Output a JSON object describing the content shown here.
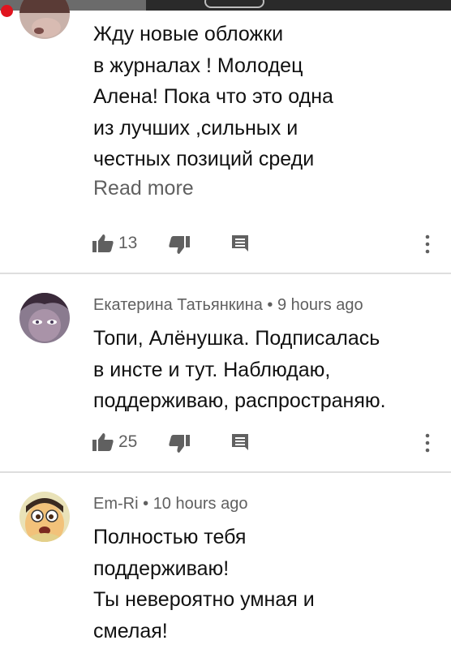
{
  "comments": [
    {
      "author": "",
      "time": "",
      "lines": [
        "Жду новые обложки",
        "в журналах ! Молодец",
        "Алена! Пока что это одна",
        "из лучших ,сильных и",
        "честных позиций среди"
      ],
      "read_more": "Read more",
      "likes": "13"
    },
    {
      "author": "Екатерина Татьянкина",
      "separator": "•",
      "time": "9 hours ago",
      "lines": [
        "Топи, Алёнушка. Подписалась",
        "в инсте и тут. Наблюдаю,",
        "поддерживаю, распространяю."
      ],
      "likes": "25"
    },
    {
      "author": "Em-Ri",
      "separator": "•",
      "time": "10 hours ago",
      "lines": [
        "Полностью тебя",
        "поддерживаю!",
        "Ты невероятно умная и",
        "смелая!"
      ]
    }
  ],
  "icons": {
    "like": "thumb-up-icon",
    "dislike": "thumb-down-icon",
    "reply": "reply-comment-icon",
    "more": "more-vertical-icon"
  },
  "colors": {
    "text": "#111111",
    "secondary": "#606060",
    "icon": "#606060",
    "divider": "#dedede",
    "recording_dot": "#e0141e"
  }
}
